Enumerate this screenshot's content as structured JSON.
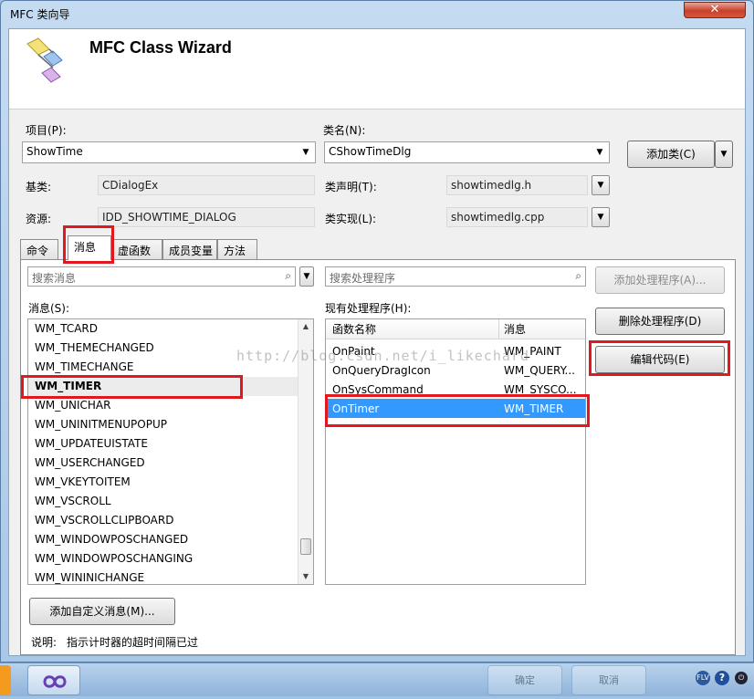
{
  "window": {
    "title": "MFC 类向导",
    "close_glyph": "✕"
  },
  "header": {
    "title": "MFC Class Wizard"
  },
  "project": {
    "label": "项目(P):",
    "value": "ShowTime"
  },
  "classname": {
    "label": "类名(N):",
    "value": "CShowTimeDlg"
  },
  "add_class_button": "添加类(C)",
  "base_class": {
    "label": "基类:",
    "value": "CDialogEx"
  },
  "resource": {
    "label": "资源:",
    "value": "IDD_SHOWTIME_DIALOG"
  },
  "class_decl": {
    "label": "类声明(T):",
    "value": "showtimedlg.h"
  },
  "class_impl": {
    "label": "类实现(L):",
    "value": "showtimedlg.cpp"
  },
  "tabs": [
    {
      "label": "命令"
    },
    {
      "label": "消息"
    },
    {
      "label": "虚函数"
    },
    {
      "label": "成员变量"
    },
    {
      "label": "方法"
    }
  ],
  "search_messages": {
    "placeholder": "搜索消息"
  },
  "search_handlers": {
    "placeholder": "搜索处理程序"
  },
  "messages": {
    "label": "消息(S):",
    "items": [
      "WM_TCARD",
      "WM_THEMECHANGED",
      "WM_TIMECHANGE",
      "WM_TIMER",
      "WM_UNICHAR",
      "WM_UNINITMENUPOPUP",
      "WM_UPDATEUISTATE",
      "WM_USERCHANGED",
      "WM_VKEYTOITEM",
      "WM_VSCROLL",
      "WM_VSCROLLCLIPBOARD",
      "WM_WINDOWPOSCHANGED",
      "WM_WINDOWPOSCHANGING",
      "WM_WININICHANGE"
    ],
    "selected": "WM_TIMER"
  },
  "handlers": {
    "label": "现有处理程序(H):",
    "columns": [
      "函数名称",
      "消息"
    ],
    "rows": [
      [
        "OnPaint",
        "WM_PAINT"
      ],
      [
        "OnQueryDragIcon",
        "WM_QUERY..."
      ],
      [
        "OnSysCommand",
        "WM_SYSCO..."
      ],
      [
        "OnTimer",
        "WM_TIMER"
      ]
    ],
    "selected": "OnTimer"
  },
  "buttons": {
    "add_handler": "添加处理程序(A)...",
    "delete_handler": "删除处理程序(D)",
    "edit_code": "编辑代码(E)",
    "add_custom_message": "添加自定义消息(M)..."
  },
  "description": {
    "label": "说明:",
    "text": "指示计时器的超时间隔已过"
  },
  "watermark": "http://blog.csdn.net/i_likechard",
  "taskbar": {
    "ok_label": "确定",
    "cancel_label": "取消"
  },
  "colors": {
    "highlight": "#e0191f",
    "selection": "#3399ff"
  }
}
